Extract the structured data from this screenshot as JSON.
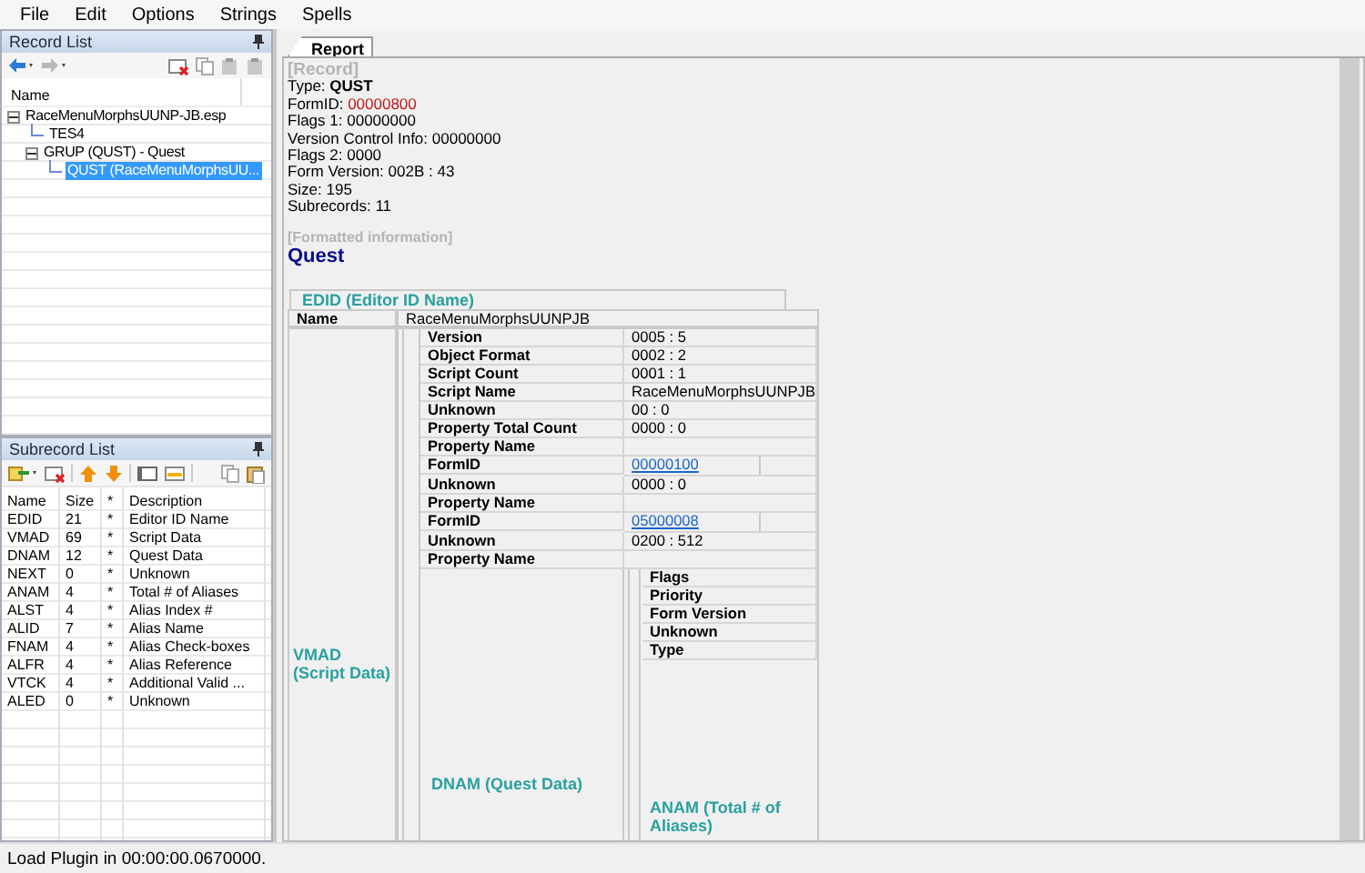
{
  "menu": [
    "File",
    "Edit",
    "Options",
    "Strings",
    "Spells"
  ],
  "record_list": {
    "title": "Record List",
    "column": "Name",
    "tree": [
      {
        "label": "RaceMenuMorphsUUNP-JB.esp",
        "expanded": true,
        "selected": false,
        "children": [
          {
            "label": "TES4",
            "selected": false
          },
          {
            "label": "GRUP (QUST) - Quest",
            "expanded": true,
            "selected": false,
            "children": [
              {
                "label": "QUST (RaceMenuMorphsUU...",
                "selected": true
              }
            ]
          }
        ]
      }
    ]
  },
  "subrecord_list": {
    "title": "Subrecord List",
    "columns": [
      "Name",
      "Size",
      "*",
      "Description"
    ],
    "rows": [
      [
        "EDID",
        "21",
        "*",
        "Editor ID Name"
      ],
      [
        "VMAD",
        "69",
        "*",
        "Script Data"
      ],
      [
        "DNAM",
        "12",
        "*",
        "Quest Data"
      ],
      [
        "NEXT",
        "0",
        "*",
        "Unknown"
      ],
      [
        "ANAM",
        "4",
        "*",
        "Total # of Aliases"
      ],
      [
        "ALST",
        "4",
        "*",
        "Alias Index #"
      ],
      [
        "ALID",
        "7",
        "*",
        "Alias Name"
      ],
      [
        "FNAM",
        "4",
        "*",
        "Alias Check-boxes"
      ],
      [
        "ALFR",
        "4",
        "*",
        "Alias Reference"
      ],
      [
        "VTCK",
        "4",
        "*",
        "Additional Valid ..."
      ],
      [
        "ALED",
        "0",
        "*",
        "Unknown"
      ]
    ]
  },
  "report": {
    "tab": "Report",
    "record_header": "[Record]",
    "fields": [
      {
        "label": "Type: ",
        "value": "QUST",
        "kind": "bold"
      },
      {
        "label": "FormID: ",
        "value": "00000800",
        "kind": "red"
      },
      {
        "label": "Flags 1: ",
        "value": "00000000",
        "kind": "plain"
      },
      {
        "label": "Version Control Info: ",
        "value": "00000000",
        "kind": "plain"
      },
      {
        "label": "Flags 2: ",
        "value": "0000",
        "kind": "plain"
      },
      {
        "label": "Form Version: ",
        "value": "002B : 43",
        "kind": "plain"
      },
      {
        "label": "Size: ",
        "value": "195",
        "kind": "plain"
      },
      {
        "label": "Subrecords: ",
        "value": "11",
        "kind": "plain"
      }
    ],
    "formatted_header": "[Formatted information]",
    "title": "Quest",
    "edid": {
      "heading": "EDID (Editor ID Name)",
      "label": "Name",
      "value": "RaceMenuMorphsUUNPJB"
    },
    "vmad": {
      "heading": "VMAD (Script Data)",
      "rows": [
        {
          "label": "Version",
          "value": "0005 : 5",
          "kind": "text"
        },
        {
          "label": "Object Format",
          "value": "0002 : 2",
          "kind": "text"
        },
        {
          "label": "Script Count",
          "value": "0001 : 1",
          "kind": "text"
        },
        {
          "label": "Script Name",
          "value": "RaceMenuMorphsUUNPJB",
          "kind": "text"
        },
        {
          "label": "Unknown",
          "value": "00 : 0",
          "kind": "text"
        },
        {
          "label": "Property Total Count",
          "value": "0000 : 0",
          "kind": "text"
        },
        {
          "label": "Property Name",
          "kind": "text"
        },
        {
          "label": "FormID",
          "value": "00000100",
          "kind": "link"
        },
        {
          "label": "Unknown",
          "value": "0000 : 0",
          "kind": "text"
        },
        {
          "label": "Property Name",
          "kind": "text"
        },
        {
          "label": "FormID",
          "value": "05000008",
          "kind": "link"
        },
        {
          "label": "Unknown",
          "value": "0200 : 512",
          "kind": "text"
        },
        {
          "label": "Property Name",
          "kind": "text"
        }
      ]
    },
    "dnam": {
      "heading": "DNAM (Quest Data)",
      "rows": [
        "Flags",
        "Priority",
        "Form Version",
        "Unknown",
        "Type"
      ]
    },
    "anam": {
      "heading": "ANAM (Total # of Aliases)"
    }
  },
  "status_bar": "Load Plugin in 00:00:00.0670000."
}
